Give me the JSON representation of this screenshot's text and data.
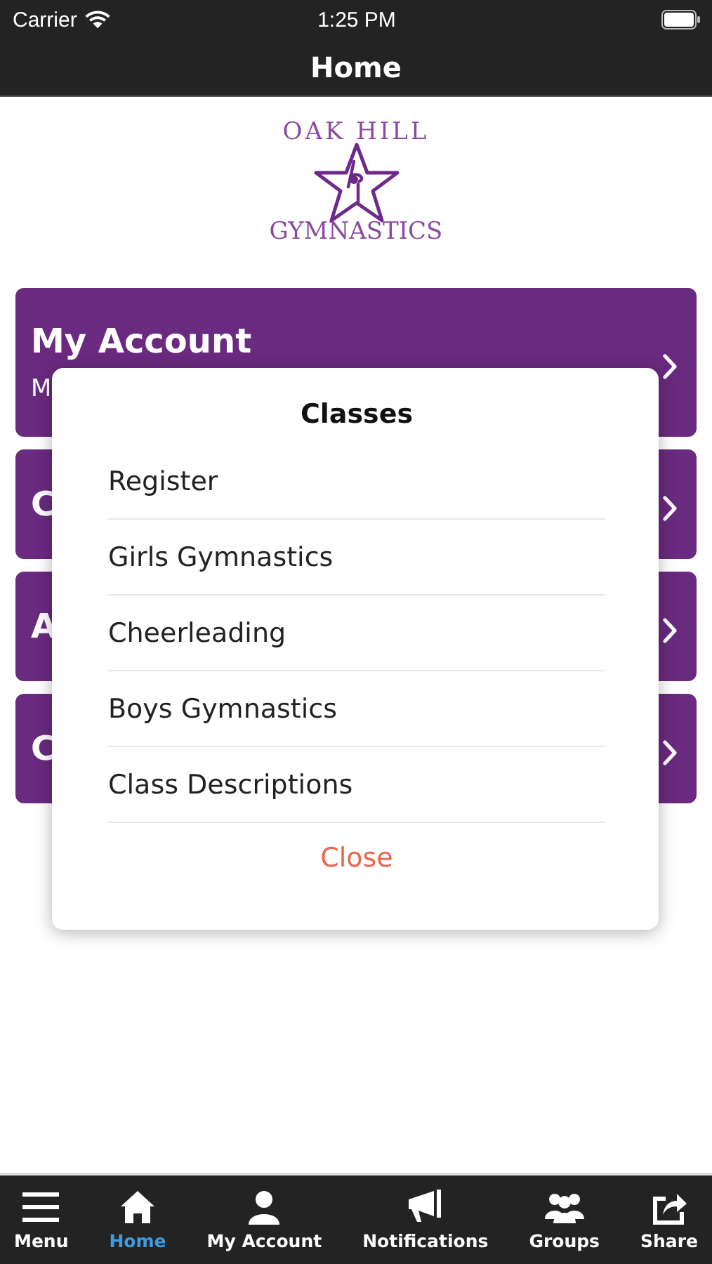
{
  "status_bar": {
    "carrier": "Carrier",
    "time": "1:25 PM"
  },
  "nav_bar": {
    "title": "Home"
  },
  "logo": {
    "top_text": "OAK HILL",
    "bottom_text": "GYMNASTICS"
  },
  "cards": [
    {
      "title": "My Account",
      "subtitle": "M"
    },
    {
      "title": "C"
    },
    {
      "title": "A"
    },
    {
      "title": "C"
    }
  ],
  "dialog": {
    "title": "Classes",
    "items": [
      "Register",
      "Girls Gymnastics",
      "Cheerleading",
      "Boys Gymnastics",
      "Class Descriptions"
    ],
    "close": "Close"
  },
  "tab_bar": [
    {
      "label": "Menu",
      "kind": "menu",
      "selected": false
    },
    {
      "label": "Home",
      "kind": "home",
      "selected": true
    },
    {
      "label": "My Account",
      "kind": "person",
      "selected": false
    },
    {
      "label": "Notifications",
      "kind": "megaphone",
      "selected": false
    },
    {
      "label": "Groups",
      "kind": "group",
      "selected": false
    },
    {
      "label": "Share",
      "kind": "share",
      "selected": false
    }
  ]
}
